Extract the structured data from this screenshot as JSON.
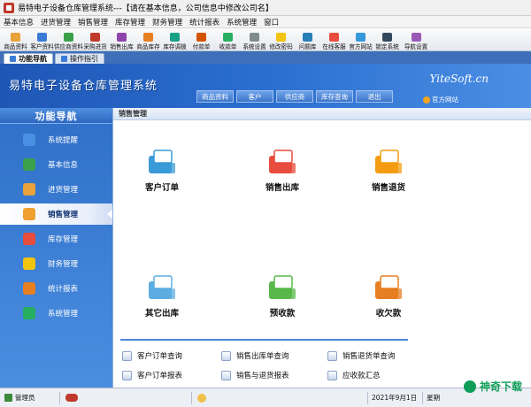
{
  "window": {
    "title": "易特电子设备仓库管理系统---【请在基本信息，公司信息中修改公司名】"
  },
  "menu": [
    "基本信息",
    "进货管理",
    "销售管理",
    "库存管理",
    "财务管理",
    "统计报表",
    "系统管理",
    "窗口"
  ],
  "toolbar": [
    {
      "label": "商品资料",
      "icon": "product-icon",
      "color": "#e7a23a"
    },
    {
      "label": "客户资料",
      "icon": "customer-icon",
      "color": "#3a7bd5"
    },
    {
      "label": "供应商资料",
      "icon": "supplier-icon",
      "color": "#3aa04a"
    },
    {
      "label": "采购进货",
      "icon": "purchase-icon",
      "color": "#c0392b"
    },
    {
      "label": "销售出库",
      "icon": "sales-out-icon",
      "color": "#8e44ad"
    },
    {
      "label": "商品库存",
      "icon": "stock-icon",
      "color": "#e67e22"
    },
    {
      "label": "库存调拨",
      "icon": "transfer-icon",
      "color": "#16a085"
    },
    {
      "label": "付款单",
      "icon": "payment-icon",
      "color": "#d35400"
    },
    {
      "label": "收款单",
      "icon": "receipt-icon",
      "color": "#27ae60"
    },
    {
      "label": "系统设置",
      "icon": "settings-icon",
      "color": "#7f8c8d"
    },
    {
      "label": "修改密码",
      "icon": "password-icon",
      "color": "#f1c40f"
    },
    {
      "label": "问题库",
      "icon": "faq-icon",
      "color": "#2980b9"
    },
    {
      "label": "在线客服",
      "icon": "online-service-icon",
      "color": "#e74c3c"
    },
    {
      "label": "官方网站",
      "icon": "website-icon",
      "color": "#3498db"
    },
    {
      "label": "锁定系统",
      "icon": "lock-icon",
      "color": "#34495e"
    },
    {
      "label": "导航设置",
      "icon": "nav-settings-icon",
      "color": "#9b59b6"
    }
  ],
  "tabs": [
    {
      "label": "功能导航",
      "active": true
    },
    {
      "label": "操作指引",
      "active": false
    }
  ],
  "banner": {
    "system_title": "易特电子设备仓库管理系统",
    "brand": "YiteSoft.cn",
    "nav": [
      "商品资料",
      "客户",
      "供应商",
      "库存查询",
      "退出"
    ],
    "site_link": "官方网站"
  },
  "sidebar": {
    "header": "功能导航",
    "items": [
      {
        "label": "系统提醒",
        "icon": "info-icon",
        "color": "#4a90e2",
        "active": false
      },
      {
        "label": "基本信息",
        "icon": "basic-info-icon",
        "color": "#3aa04a",
        "active": false
      },
      {
        "label": "进货管理",
        "icon": "purchase-box-icon",
        "color": "#e7a23a",
        "active": false
      },
      {
        "label": "销售管理",
        "icon": "sales-box-icon",
        "color": "#f0a030",
        "active": true
      },
      {
        "label": "库存管理",
        "icon": "warehouse-icon",
        "color": "#e74c3c",
        "active": false
      },
      {
        "label": "财务管理",
        "icon": "finance-icon",
        "color": "#f1c40f",
        "active": false
      },
      {
        "label": "统计报表",
        "icon": "report-icon",
        "color": "#e67e22",
        "active": false
      },
      {
        "label": "系统管理",
        "icon": "system-icon",
        "color": "#27ae60",
        "active": false
      }
    ]
  },
  "main": {
    "section_title": "销售管理",
    "functions": [
      {
        "label": "客户订单",
        "icon": "customer-order-icon",
        "color": "#3a9bd8"
      },
      {
        "label": "销售出库",
        "icon": "sales-outbound-icon",
        "color": "#e74c3c"
      },
      {
        "label": "销售退货",
        "icon": "sales-return-icon",
        "color": "#f39c12"
      },
      {
        "label": "其它出库",
        "icon": "other-outbound-icon",
        "color": "#5dade2"
      },
      {
        "label": "预收款",
        "icon": "prepayment-icon",
        "color": "#58b84a"
      },
      {
        "label": "收欠款",
        "icon": "collect-debt-icon",
        "color": "#e67e22"
      }
    ],
    "quick_links": [
      "客户订单查询",
      "销售出库单查询",
      "销售退货单查询",
      "客户订单报表",
      "销售与退货报表",
      "应收款汇总"
    ]
  },
  "status": {
    "user": "管理员",
    "date": "2021年9月1日",
    "weekday": "星期"
  },
  "watermark": "神奇下载"
}
